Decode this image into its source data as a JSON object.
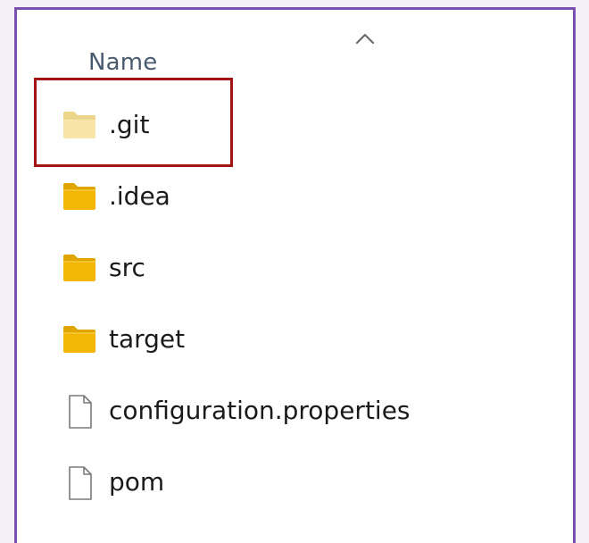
{
  "header": {
    "name_column": "Name",
    "sort_icon": "chevron-up-icon"
  },
  "files": [
    {
      "name": ".git",
      "type": "folder",
      "icon": "folder-icon",
      "hidden": true,
      "highlighted": true
    },
    {
      "name": ".idea",
      "type": "folder",
      "icon": "folder-icon",
      "hidden": false
    },
    {
      "name": "src",
      "type": "folder",
      "icon": "folder-icon",
      "hidden": false
    },
    {
      "name": "target",
      "type": "folder",
      "icon": "folder-icon",
      "hidden": false
    },
    {
      "name": "configuration.properties",
      "type": "file",
      "icon": "document-icon",
      "hidden": false
    },
    {
      "name": "pom",
      "type": "file",
      "icon": "document-icon",
      "hidden": false
    }
  ],
  "colors": {
    "frame_border": "#7b4fb0",
    "highlight_border": "#a31515",
    "folder": "#f2b705",
    "folder_hidden": "#f7e4a6",
    "header_text": "#4a5a6e"
  }
}
